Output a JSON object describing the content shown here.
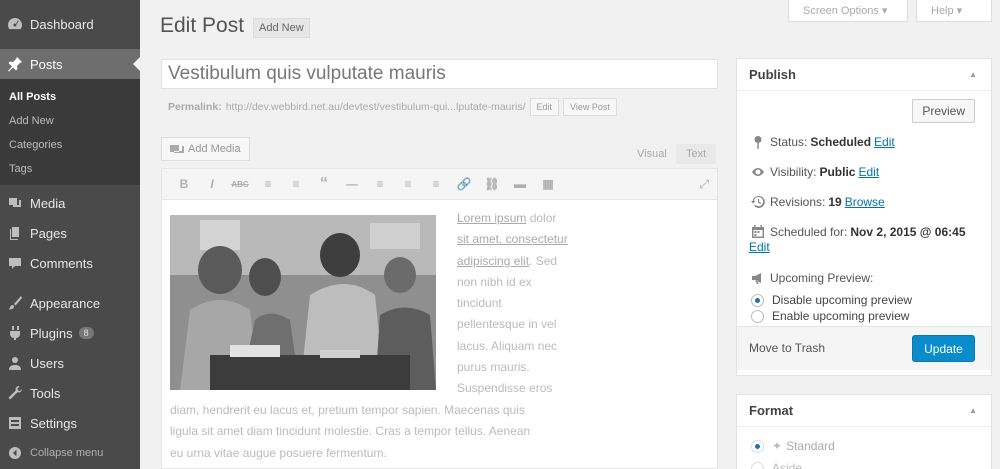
{
  "sidebar": {
    "items": [
      {
        "label": "Dashboard",
        "icon": "dashboard-icon"
      },
      {
        "label": "Posts",
        "icon": "pin-icon"
      },
      {
        "label": "Media",
        "icon": "media-icon"
      },
      {
        "label": "Pages",
        "icon": "pages-icon"
      },
      {
        "label": "Comments",
        "icon": "comments-icon"
      },
      {
        "label": "Appearance",
        "icon": "paintbrush-icon"
      },
      {
        "label": "Plugins",
        "icon": "plugin-icon",
        "badge": "8"
      },
      {
        "label": "Users",
        "icon": "users-icon"
      },
      {
        "label": "Tools",
        "icon": "wrench-icon"
      },
      {
        "label": "Settings",
        "icon": "settings-icon"
      }
    ],
    "posts_sub": [
      "All Posts",
      "Add New",
      "Categories",
      "Tags"
    ],
    "collapse_label": "Collapse menu"
  },
  "top": {
    "screen_options": "Screen Options ▾",
    "help": "Help ▾"
  },
  "header": {
    "title": "Edit Post",
    "add_new": "Add New"
  },
  "post": {
    "title": "Vestibulum quis vulputate mauris",
    "permalink_label": "Permalink:",
    "permalink_url": "http://dev.webbird.net.au/devtest/vestibulum-qui...lputate-mauris/",
    "edit_btn": "Edit",
    "view_btn": "View Post"
  },
  "editor": {
    "add_media": "Add Media",
    "tab_visual": "Visual",
    "tab_text": "Text",
    "toolbar": [
      "B",
      "I",
      "ABC",
      "≡",
      "≡",
      "“",
      "—",
      "≡",
      "≡",
      "≡",
      "🔗",
      "⛓",
      "▬",
      "▦"
    ],
    "side_lines": [
      {
        "link": "Lorem ipsum",
        "rest": " dolor"
      },
      {
        "link": "sit amet, consectetur",
        "rest": ""
      },
      {
        "link": "adipiscing elit",
        "rest": ". Sed"
      },
      {
        "link": "",
        "rest": "non nibh id ex"
      },
      {
        "link": "",
        "rest": "tincidunt"
      },
      {
        "link": "",
        "rest": "pellentesque in vel"
      },
      {
        "link": "",
        "rest": "lacus. Aliquam nec"
      },
      {
        "link": "",
        "rest": "purus mauris."
      },
      {
        "link": "",
        "rest": "Suspendisse eros"
      }
    ],
    "full_lines": [
      "diam, hendrerit eu lacus et, pretium tempor sapien. Maecenas quis",
      "ligula sit amet diam tincidunt molestie. Cras a tempor tellus. Aenean",
      "eu urna vitae augue posuere fermentum."
    ]
  },
  "publish": {
    "title": "Publish",
    "preview": "Preview",
    "status_label": "Status:",
    "status_value": "Scheduled",
    "visibility_label": "Visibility:",
    "visibility_value": "Public",
    "revisions_label": "Revisions:",
    "revisions_value": "19",
    "browse": "Browse",
    "scheduled_label": "Scheduled for:",
    "scheduled_value": "Nov 2, 2015 @ 06:45",
    "edit": "Edit",
    "upcoming_label": "Upcoming Preview:",
    "option_disable": "Disable upcoming preview",
    "option_enable": "Enable upcoming preview",
    "trash": "Move to Trash",
    "update": "Update"
  },
  "format": {
    "title": "Format",
    "options": [
      "Standard",
      "Aside"
    ]
  },
  "colors": {
    "primary_button": "#0a8ccc",
    "link": "#0073aa",
    "sidebar": "#4a4a4a"
  }
}
